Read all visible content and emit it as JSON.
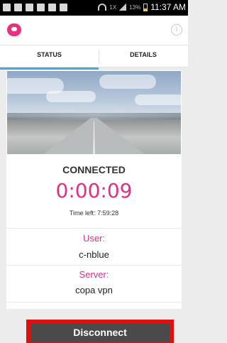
{
  "status_bar": {
    "roaming": "1X",
    "battery_level": "13%",
    "time": "11:37 AM"
  },
  "tabs": [
    {
      "label": "STATUS"
    },
    {
      "label": "DETAILS"
    }
  ],
  "status": {
    "state": "CONNECTED",
    "elapsed": "0:00:09",
    "time_left": "Time left: 7:59:28",
    "user_label": "User:",
    "user_value": "c-nblue",
    "server_label": "Server:",
    "server_value": "copa vpn"
  },
  "actions": {
    "disconnect_label": "Disconnect"
  },
  "colors": {
    "accent": "#e42f83",
    "tab_indicator": "#4aa9d8",
    "button_bg": "#4a4a4a",
    "button_outline": "#e11010"
  },
  "icons": {
    "app_logo": "app-logo-icon",
    "info": "info-icon"
  }
}
